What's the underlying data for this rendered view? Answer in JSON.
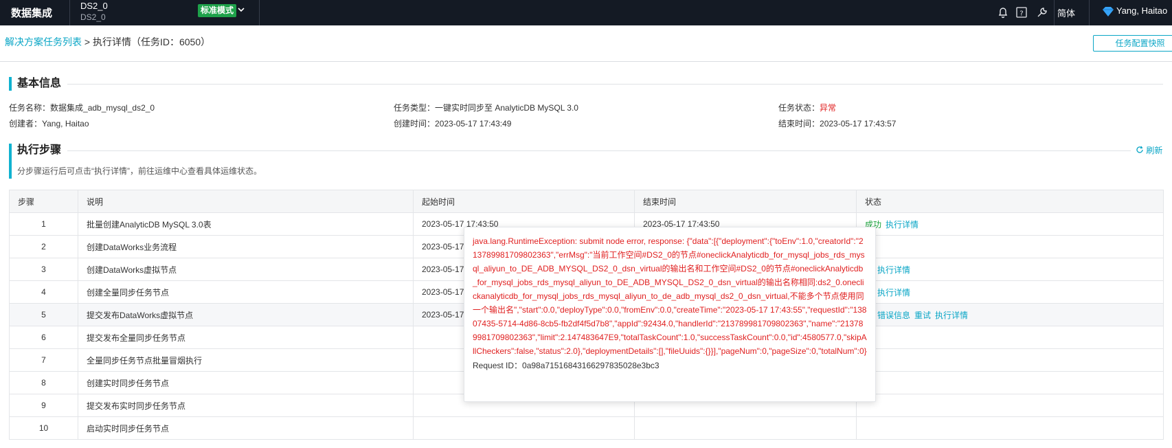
{
  "topbar": {
    "brand": "数据集成",
    "workspace_name": "DS2_0",
    "workspace_sub": "DS2_0",
    "mode": "标准模式",
    "language": "简体",
    "user": "Yang, Haitao",
    "icons": [
      "bell-icon",
      "help-icon",
      "wrench-icon",
      "user-diamond-icon"
    ]
  },
  "breadcrumb": {
    "link": "解决方案任务列表",
    "sep": " > ",
    "current": "执行详情（任务ID：6050）"
  },
  "snapshot_button": "任务配置快照",
  "basic": {
    "title": "基本信息",
    "task_name_label": "任务名称：",
    "task_name": "数据集成_adb_mysql_ds2_0",
    "task_type_label": "任务类型：",
    "task_type": "一键实时同步至 AnalyticDB MySQL 3.0",
    "task_status_label": "任务状态：",
    "task_status": "异常",
    "creator_label": "创建者：",
    "creator": "Yang, Haitao",
    "create_time_label": "创建时间：",
    "create_time": "2023-05-17 17:43:49",
    "end_time_label": "结束时间：",
    "end_time": "2023-05-17 17:43:57"
  },
  "steps": {
    "title": "执行步骤",
    "refresh": "刷新",
    "hint": "分步骤运行后可点击“执行详情”，前往运维中心查看具体运维状态。",
    "columns": [
      "步骤",
      "说明",
      "起始时间",
      "结束时间",
      "状态"
    ],
    "rows": [
      {
        "step": "1",
        "desc": "批量创建AnalyticDB MySQL 3.0表",
        "start": "2023-05-17 17:43:50",
        "end": "2023-05-17 17:43:50",
        "status": "成功",
        "actions": [
          "执行详情"
        ]
      },
      {
        "step": "2",
        "desc": "创建DataWorks业务流程",
        "start": "2023-05-17",
        "end": "",
        "status": "功",
        "actions": []
      },
      {
        "step": "3",
        "desc": "创建DataWorks虚拟节点",
        "start": "2023-05-17",
        "end": "",
        "status": "功",
        "actions": [
          "执行详情"
        ]
      },
      {
        "step": "4",
        "desc": "创建全量同步任务节点",
        "start": "2023-05-17",
        "end": "",
        "status": "功",
        "actions": [
          "执行详情"
        ]
      },
      {
        "step": "5",
        "desc": "提交发布DataWorks虚拟节点",
        "start": "2023-05-17",
        "end": "",
        "status": "常",
        "actions": [
          "错误信息",
          "重试",
          "执行详情"
        ]
      },
      {
        "step": "6",
        "desc": "提交发布全量同步任务节点",
        "start": "",
        "end": "",
        "status": "",
        "actions": []
      },
      {
        "step": "7",
        "desc": "全量同步任务节点批量冒烟执行",
        "start": "",
        "end": "",
        "status": "",
        "actions": []
      },
      {
        "step": "8",
        "desc": "创建实时同步任务节点",
        "start": "",
        "end": "",
        "status": "",
        "actions": []
      },
      {
        "step": "9",
        "desc": "提交发布实时同步任务节点",
        "start": "",
        "end": "",
        "status": "",
        "actions": []
      },
      {
        "step": "10",
        "desc": "启动实时同步任务节点",
        "start": "",
        "end": "",
        "status": "",
        "actions": []
      }
    ]
  },
  "error_popover": {
    "message": "java.lang.RuntimeException: submit node error, response: {\"data\":[{\"deployment\":{\"toEnv\":1.0,\"creatorId\":\"213789981709802363\",\"errMsg\":\"当前工作空间#DS2_0的节点#oneclickAnalyticdb_for_mysql_jobs_rds_mysql_aliyun_to_DE_ADB_MYSQL_DS2_0_dsn_virtual的输出名和工作空间#DS2_0的节点#oneclickAnalyticdb_for_mysql_jobs_rds_mysql_aliyun_to_DE_ADB_MYSQL_DS2_0_dsn_virtual的输出名称相同:ds2_0.oneclickanalyticdb_for_mysql_jobs_rds_mysql_aliyun_to_de_adb_mysql_ds2_0_dsn_virtual,不能多个节点使用同一个输出名\",\"start\":0.0,\"deployType\":0.0,\"fromEnv\":0.0,\"createTime\":\"2023-05-17 17:43:55\",\"requestId\":\"13807435-5714-4d86-8cb5-fb2df4f5d7b8\",\"appId\":92434.0,\"handlerId\":\"213789981709802363\",\"name\":\"213789981709802363\",\"limit\":2.147483647E9,\"totalTaskCount\":1.0,\"successTaskCount\":0.0,\"id\":4580577.0,\"skipAllCheckers\":false,\"status\":2.0},\"deploymentDetails\":[],\"fileUuids\":{}}],\"pageNum\":0,\"pageSize\":0,\"totalNum\":0}",
    "request_id": "Request ID：0a98a71516843166297835028e3bc3"
  }
}
